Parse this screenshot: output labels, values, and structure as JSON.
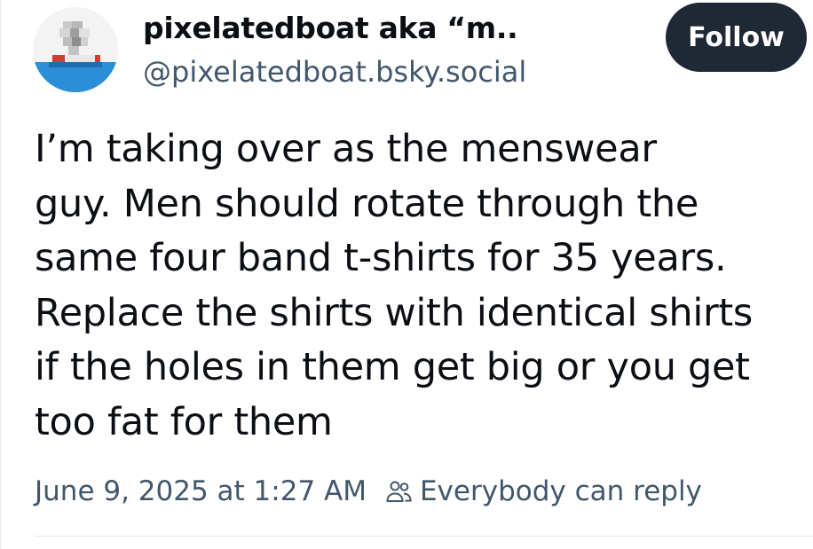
{
  "author": {
    "display_name": "pixelatedboat aka “m..",
    "handle": "@pixelatedboat.bsky.social"
  },
  "actions": {
    "follow_label": "Follow"
  },
  "post": {
    "lines": [
      "I’m taking over as the menswear",
      "guy. Men should rotate through the",
      "same four band t-shirts for 35 years.",
      "Replace the shirts with identical shirts",
      "if the holes in them get big or you get",
      "too fat for them"
    ],
    "timestamp": "June 9, 2025 at 1:27 AM",
    "reply_setting": "Everybody can reply"
  },
  "icons": {
    "avatar": "pixelated-boat-avatar",
    "reply_setting": "people-icon"
  },
  "colors": {
    "follow_bg": "#1e2935",
    "secondary_text": "#42576c",
    "primary_text": "#0b0f14"
  }
}
